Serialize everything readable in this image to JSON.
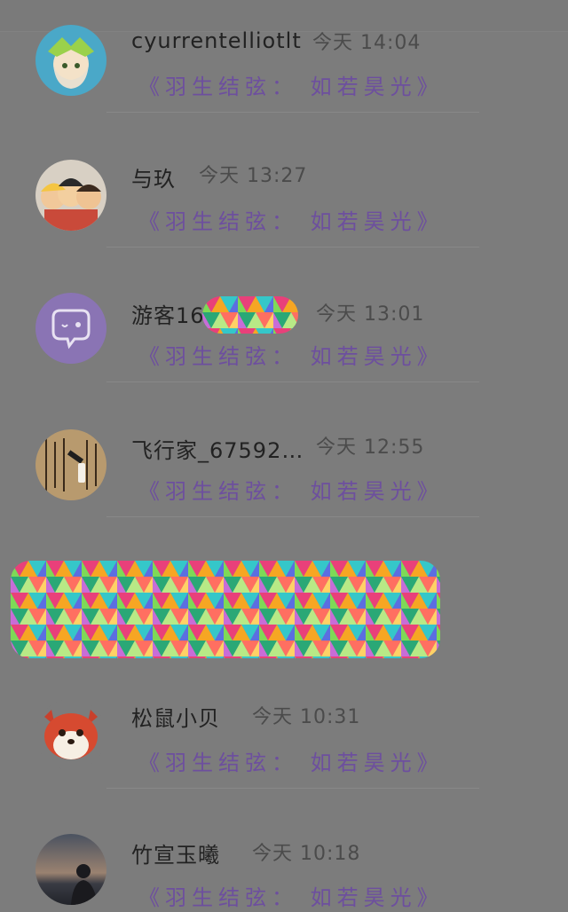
{
  "comments": [
    {
      "name": "cyurrentelliotlt",
      "time": "今天 14:04",
      "message": "《羽生结弦： 如若昊光》",
      "avatar": "anime-girl-avatar"
    },
    {
      "name": "与玖",
      "time": "今天 13:27",
      "message": "《羽生结弦： 如若昊光》",
      "avatar": "cartoon-trio-avatar"
    },
    {
      "name": "游客16",
      "time": "今天 13:01",
      "message": "《羽生结弦： 如若昊光》",
      "avatar": "default-chat-avatar"
    },
    {
      "name": "飞行家_67592…",
      "time": "今天 12:55",
      "message": "《羽生结弦： 如若昊光》",
      "avatar": "calligraphy-avatar"
    },
    {
      "name": "松鼠小贝",
      "time": "今天 10:31",
      "message": "《羽生结弦： 如若昊光》",
      "avatar": "red-squirrel-avatar"
    },
    {
      "name": "竹宣玉曦",
      "time": "今天 10:18",
      "message": "《羽生结弦： 如若昊光》",
      "avatar": "sunset-silhouette-avatar"
    }
  ],
  "colors": {
    "background": "#7c7c7c",
    "name_text": "#222222",
    "time_text": "#4b4b4b",
    "message_text": "#6d4f9e"
  }
}
